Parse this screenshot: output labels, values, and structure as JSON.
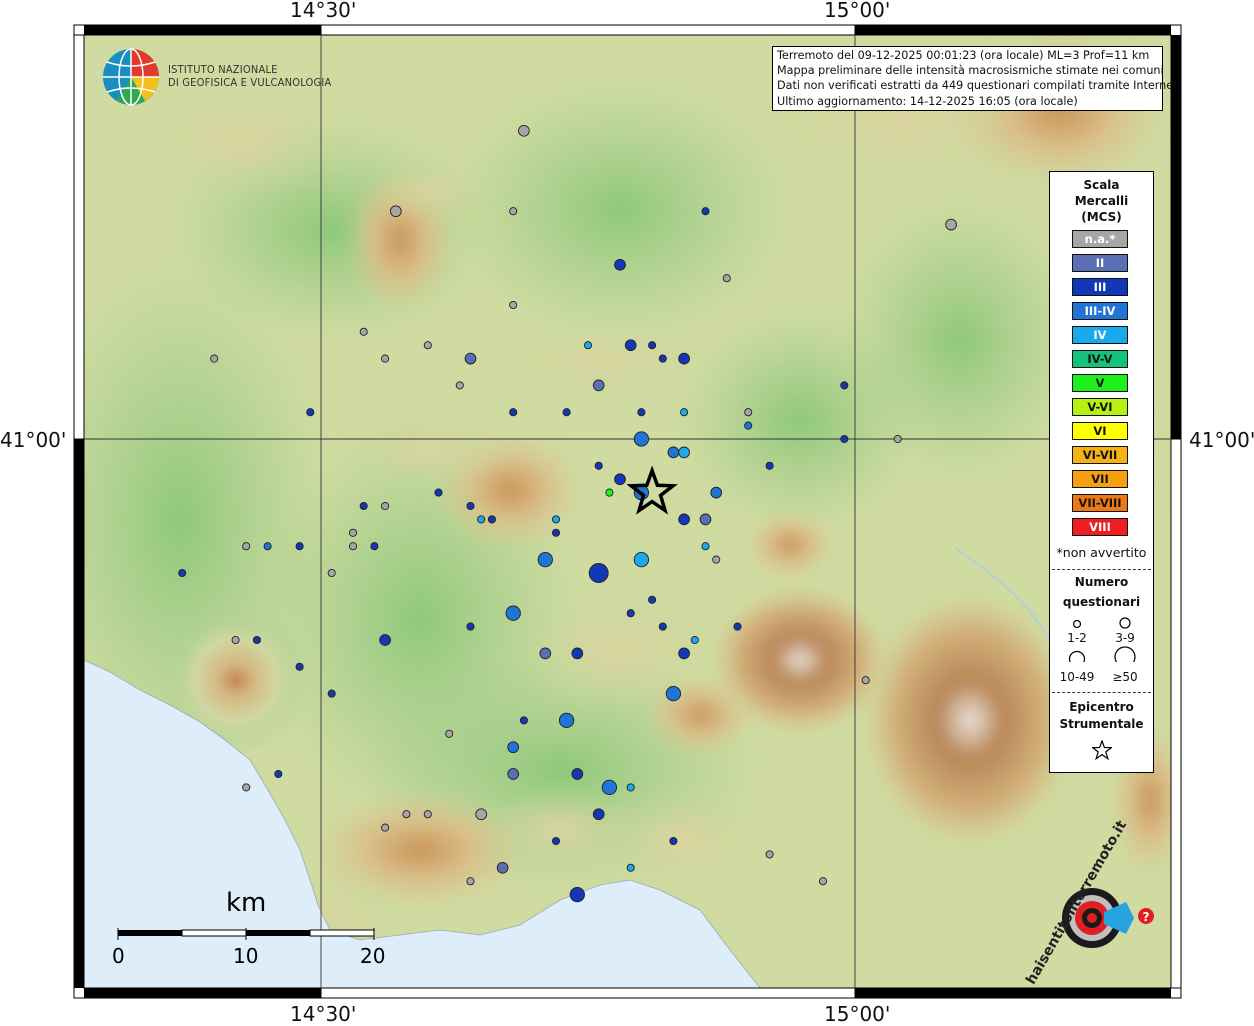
{
  "map": {
    "coords": {
      "lon_left": "14°30'",
      "lon_right": "15°00'",
      "lat": "41°00'"
    },
    "institute": {
      "line1": "ISTITUTO NAZIONALE",
      "line2": "DI GEOFISICA E VULCANOLOGIA"
    },
    "info": {
      "line1": "Terremoto del 09-12-2025 00:01:23 (ora locale) ML=3 Prof=11 km",
      "line2": "Mappa preliminare delle intensità macrosismiche stimate nei comuni",
      "line3": "Dati non verificati estratti da 449 questionari compilati tramite Internet.",
      "line4": "Ultimo aggiornamento: 14-12-2025 16:05 (ora locale)"
    },
    "legend": {
      "title1": "Scala",
      "title2": "Mercalli",
      "title3": "(MCS)",
      "classes": [
        {
          "label": "n.a.*",
          "color": "#a6a6a6"
        },
        {
          "label": "II",
          "color": "#5a6fb3"
        },
        {
          "label": "III",
          "color": "#1238b5"
        },
        {
          "label": "III-IV",
          "color": "#1f74d6"
        },
        {
          "label": "IV",
          "color": "#1aa9ea"
        },
        {
          "label": "IV-V",
          "color": "#14c37a"
        },
        {
          "label": "V",
          "color": "#1ef01e"
        },
        {
          "label": "V-VI",
          "color": "#b6f013"
        },
        {
          "label": "VI",
          "color": "#ffff00"
        },
        {
          "label": "VI-VII",
          "color": "#f5b313"
        },
        {
          "label": "VII",
          "color": "#f5a00f"
        },
        {
          "label": "VII-VIII",
          "color": "#f07814"
        },
        {
          "label": "VIII",
          "color": "#f01e1e"
        }
      ],
      "not_felt_note": "*non avvertito",
      "count_title1": "Numero",
      "count_title2": "questionari",
      "sizes": [
        "1-2",
        "3-9",
        "10-49",
        "≥50"
      ],
      "epicenter_title1": "Epicentro",
      "epicenter_title2": "Strumentale"
    },
    "scale_bar": {
      "unit": "km",
      "ticks": [
        "0",
        "10",
        "20"
      ]
    },
    "logo_text": "haisentitoilterremoto.it",
    "logo_www": "www.",
    "points": [
      {
        "mcs": "n.a.*",
        "n": "3-9",
        "lon": 14.69,
        "lat": 41.23
      },
      {
        "mcs": "n.a.*",
        "n": "3-9",
        "lon": 14.57,
        "lat": 41.17
      },
      {
        "mcs": "n.a.*",
        "n": "1-2",
        "lon": 14.68,
        "lat": 41.17
      },
      {
        "mcs": "n.a.*",
        "n": "1-2",
        "lon": 14.68,
        "lat": 41.1
      },
      {
        "mcs": "III",
        "n": "1-2",
        "lon": 14.86,
        "lat": 41.17
      },
      {
        "mcs": "III",
        "n": "3-9",
        "lon": 14.78,
        "lat": 41.13
      },
      {
        "mcs": "n.a.*",
        "n": "1-2",
        "lon": 14.88,
        "lat": 41.12
      },
      {
        "mcs": "n.a.*",
        "n": "3-9",
        "lon": 15.09,
        "lat": 41.16
      },
      {
        "mcs": "n.a.*",
        "n": "1-2",
        "lon": 14.54,
        "lat": 41.08
      },
      {
        "mcs": "n.a.*",
        "n": "1-2",
        "lon": 14.6,
        "lat": 41.07
      },
      {
        "mcs": "n.a.*",
        "n": "1-2",
        "lon": 14.63,
        "lat": 41.04
      },
      {
        "mcs": "II",
        "n": "3-9",
        "lon": 14.64,
        "lat": 41.06
      },
      {
        "mcs": "IV",
        "n": "1-2",
        "lon": 14.75,
        "lat": 41.07
      },
      {
        "mcs": "III",
        "n": "3-9",
        "lon": 14.79,
        "lat": 41.07
      },
      {
        "mcs": "III",
        "n": "1-2",
        "lon": 14.81,
        "lat": 41.07
      },
      {
        "mcs": "III",
        "n": "1-2",
        "lon": 14.82,
        "lat": 41.06
      },
      {
        "mcs": "III",
        "n": "3-9",
        "lon": 14.84,
        "lat": 41.06
      },
      {
        "mcs": "II",
        "n": "3-9",
        "lon": 14.76,
        "lat": 41.04
      },
      {
        "mcs": "n.a.*",
        "n": "1-2",
        "lon": 14.4,
        "lat": 41.06
      },
      {
        "mcs": "n.a.*",
        "n": "1-2",
        "lon": 14.56,
        "lat": 41.06
      },
      {
        "mcs": "III",
        "n": "1-2",
        "lon": 14.49,
        "lat": 41.02
      },
      {
        "mcs": "III",
        "n": "1-2",
        "lon": 14.68,
        "lat": 41.02
      },
      {
        "mcs": "III",
        "n": "1-2",
        "lon": 14.73,
        "lat": 41.02
      },
      {
        "mcs": "III-IV",
        "n": "10-49",
        "lon": 14.8,
        "lat": 41.0
      },
      {
        "mcs": "IV",
        "n": "1-2",
        "lon": 14.84,
        "lat": 41.02
      },
      {
        "mcs": "n.a.*",
        "n": "1-2",
        "lon": 14.9,
        "lat": 41.02
      },
      {
        "mcs": "III-IV",
        "n": "1-2",
        "lon": 14.9,
        "lat": 41.01
      },
      {
        "mcs": "III",
        "n": "1-2",
        "lon": 14.99,
        "lat": 41.04
      },
      {
        "mcs": "III",
        "n": "1-2",
        "lon": 14.99,
        "lat": 41.0
      },
      {
        "mcs": "n.a.*",
        "n": "1-2",
        "lon": 15.04,
        "lat": 41.0
      },
      {
        "mcs": "III-IV",
        "n": "3-9",
        "lon": 14.83,
        "lat": 40.99
      },
      {
        "mcs": "IV",
        "n": "3-9",
        "lon": 14.84,
        "lat": 40.99
      },
      {
        "mcs": "III",
        "n": "1-2",
        "lon": 14.76,
        "lat": 40.98
      },
      {
        "mcs": "III",
        "n": "3-9",
        "lon": 14.78,
        "lat": 40.97
      },
      {
        "mcs": "V",
        "n": "1-2",
        "lon": 14.77,
        "lat": 40.96
      },
      {
        "mcs": "III-IV",
        "n": "10-49",
        "lon": 14.8,
        "lat": 40.96
      },
      {
        "mcs": "III-IV",
        "n": "3-9",
        "lon": 14.87,
        "lat": 40.96
      },
      {
        "mcs": "III",
        "n": "1-2",
        "lon": 14.92,
        "lat": 40.98
      },
      {
        "mcs": "III",
        "n": "1-2",
        "lon": 14.61,
        "lat": 40.96
      },
      {
        "mcs": "III",
        "n": "1-2",
        "lon": 14.64,
        "lat": 40.95
      },
      {
        "mcs": "IV",
        "n": "1-2",
        "lon": 14.65,
        "lat": 40.94
      },
      {
        "mcs": "III",
        "n": "1-2",
        "lon": 14.66,
        "lat": 40.94
      },
      {
        "mcs": "n.a.*",
        "n": "1-2",
        "lon": 14.56,
        "lat": 40.95
      },
      {
        "mcs": "III",
        "n": "1-2",
        "lon": 14.54,
        "lat": 40.95
      },
      {
        "mcs": "n.a.*",
        "n": "1-2",
        "lon": 14.53,
        "lat": 40.93
      },
      {
        "mcs": "n.a.*",
        "n": "1-2",
        "lon": 14.53,
        "lat": 40.92
      },
      {
        "mcs": "III",
        "n": "1-2",
        "lon": 14.55,
        "lat": 40.92
      },
      {
        "mcs": "IV",
        "n": "1-2",
        "lon": 14.72,
        "lat": 40.94
      },
      {
        "mcs": "III",
        "n": "1-2",
        "lon": 14.72,
        "lat": 40.93
      },
      {
        "mcs": "III",
        "n": "3-9",
        "lon": 14.84,
        "lat": 40.94
      },
      {
        "mcs": "II",
        "n": "3-9",
        "lon": 14.86,
        "lat": 40.94
      },
      {
        "mcs": "IV",
        "n": "1-2",
        "lon": 14.86,
        "lat": 40.92
      },
      {
        "mcs": "n.a.*",
        "n": "1-2",
        "lon": 14.87,
        "lat": 40.91
      },
      {
        "mcs": "III-IV",
        "n": "10-49",
        "lon": 14.71,
        "lat": 40.91
      },
      {
        "mcs": "III",
        "n": "50+",
        "lon": 14.76,
        "lat": 40.9
      },
      {
        "mcs": "IV",
        "n": "10-49",
        "lon": 14.8,
        "lat": 40.91
      },
      {
        "mcs": "III",
        "n": "1-2",
        "lon": 14.81,
        "lat": 40.88
      },
      {
        "mcs": "III",
        "n": "1-2",
        "lon": 14.79,
        "lat": 40.87
      },
      {
        "mcs": "III",
        "n": "1-2",
        "lon": 14.89,
        "lat": 40.86
      },
      {
        "mcs": "III-IV",
        "n": "10-49",
        "lon": 14.68,
        "lat": 40.87
      },
      {
        "mcs": "III",
        "n": "1-2",
        "lon": 14.64,
        "lat": 40.86
      },
      {
        "mcs": "n.a.*",
        "n": "1-2",
        "lon": 14.43,
        "lat": 40.92
      },
      {
        "mcs": "III-IV",
        "n": "1-2",
        "lon": 14.45,
        "lat": 40.92
      },
      {
        "mcs": "III",
        "n": "1-2",
        "lon": 14.37,
        "lat": 40.9
      },
      {
        "mcs": "n.a.*",
        "n": "1-2",
        "lon": 14.51,
        "lat": 40.9
      },
      {
        "mcs": "n.a.*",
        "n": "1-2",
        "lon": 14.42,
        "lat": 40.85
      },
      {
        "mcs": "III",
        "n": "1-2",
        "lon": 14.44,
        "lat": 40.85
      },
      {
        "mcs": "III",
        "n": "3-9",
        "lon": 14.56,
        "lat": 40.85
      },
      {
        "mcs": "II",
        "n": "3-9",
        "lon": 14.71,
        "lat": 40.84
      },
      {
        "mcs": "III",
        "n": "3-9",
        "lon": 14.74,
        "lat": 40.84
      },
      {
        "mcs": "III",
        "n": "1-2",
        "lon": 14.82,
        "lat": 40.86
      },
      {
        "mcs": "IV",
        "n": "1-2",
        "lon": 14.85,
        "lat": 40.85
      },
      {
        "mcs": "III",
        "n": "3-9",
        "lon": 14.84,
        "lat": 40.84
      },
      {
        "mcs": "III",
        "n": "1-2",
        "lon": 14.48,
        "lat": 40.83
      },
      {
        "mcs": "III",
        "n": "1-2",
        "lon": 14.51,
        "lat": 40.81
      },
      {
        "mcs": "III-IV",
        "n": "10-49",
        "lon": 14.83,
        "lat": 40.81
      },
      {
        "mcs": "n.a.*",
        "n": "1-2",
        "lon": 15.01,
        "lat": 40.82
      },
      {
        "mcs": "III",
        "n": "1-2",
        "lon": 14.69,
        "lat": 40.79
      },
      {
        "mcs": "III-IV",
        "n": "10-49",
        "lon": 14.73,
        "lat": 40.79
      },
      {
        "mcs": "n.a.*",
        "n": "1-2",
        "lon": 14.62,
        "lat": 40.78
      },
      {
        "mcs": "III-IV",
        "n": "3-9",
        "lon": 14.68,
        "lat": 40.77
      },
      {
        "mcs": "II",
        "n": "3-9",
        "lon": 14.68,
        "lat": 40.75
      },
      {
        "mcs": "III",
        "n": "3-9",
        "lon": 14.74,
        "lat": 40.75
      },
      {
        "mcs": "III-IV",
        "n": "10-49",
        "lon": 14.77,
        "lat": 40.74
      },
      {
        "mcs": "IV",
        "n": "1-2",
        "lon": 14.79,
        "lat": 40.74
      },
      {
        "mcs": "III",
        "n": "1-2",
        "lon": 14.46,
        "lat": 40.75
      },
      {
        "mcs": "n.a.*",
        "n": "1-2",
        "lon": 14.43,
        "lat": 40.74
      },
      {
        "mcs": "n.a.*",
        "n": "1-2",
        "lon": 14.6,
        "lat": 40.72
      },
      {
        "mcs": "n.a.*",
        "n": "3-9",
        "lon": 14.65,
        "lat": 40.72
      },
      {
        "mcs": "n.a.*",
        "n": "1-2",
        "lon": 14.58,
        "lat": 40.72
      },
      {
        "mcs": "n.a.*",
        "n": "1-2",
        "lon": 14.56,
        "lat": 40.71
      },
      {
        "mcs": "III",
        "n": "3-9",
        "lon": 14.76,
        "lat": 40.72
      },
      {
        "mcs": "III",
        "n": "1-2",
        "lon": 14.72,
        "lat": 40.7
      },
      {
        "mcs": "III",
        "n": "1-2",
        "lon": 14.83,
        "lat": 40.7
      },
      {
        "mcs": "n.a.*",
        "n": "1-2",
        "lon": 14.92,
        "lat": 40.69
      },
      {
        "mcs": "II",
        "n": "3-9",
        "lon": 14.67,
        "lat": 40.68
      },
      {
        "mcs": "IV",
        "n": "1-2",
        "lon": 14.79,
        "lat": 40.68
      },
      {
        "mcs": "n.a.*",
        "n": "1-2",
        "lon": 14.64,
        "lat": 40.67
      },
      {
        "mcs": "n.a.*",
        "n": "1-2",
        "lon": 14.97,
        "lat": 40.67
      },
      {
        "mcs": "III",
        "n": "10-49",
        "lon": 14.74,
        "lat": 40.66
      },
      {
        "mcs": "III",
        "n": "1-2",
        "lon": 14.48,
        "lat": 40.92
      },
      {
        "mcs": "III",
        "n": "1-2",
        "lon": 14.8,
        "lat": 41.02
      }
    ],
    "epicenter": {
      "lon": 14.81,
      "lat": 40.96
    }
  }
}
